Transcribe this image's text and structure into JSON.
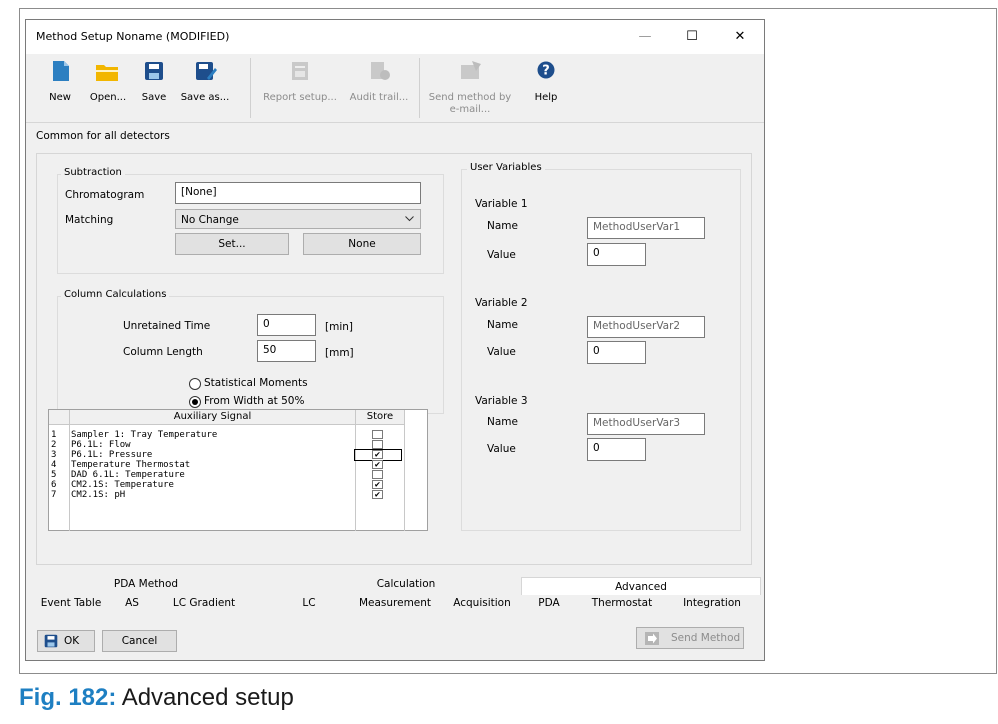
{
  "window": {
    "title": "Method Setup Noname (MODIFIED)",
    "controls": {
      "minimize": "—",
      "maximize": "☐",
      "close": "✕"
    }
  },
  "toolbar": {
    "new": "New",
    "open": "Open...",
    "save": "Save",
    "save_as": "Save as...",
    "report_setup": "Report setup...",
    "audit_trail": "Audit trail...",
    "send_method_line1": "Send method by",
    "send_method_line2": "e-mail...",
    "help": "Help"
  },
  "section_label": "Common for all detectors",
  "subtraction": {
    "title": "Subtraction",
    "chromatogram_label": "Chromatogram",
    "chromatogram_value": "[None]",
    "matching_label": "Matching",
    "matching_value": "No Change",
    "set_button": "Set...",
    "none_button": "None"
  },
  "column_calculations": {
    "title": "Column Calculations",
    "unretained_label": "Unretained Time",
    "unretained_value": "0",
    "unretained_unit": "[min]",
    "length_label": "Column Length",
    "length_value": "50",
    "length_unit": "[mm]",
    "radio_statistical": "Statistical Moments",
    "radio_width": "From Width at 50%",
    "selected": "width"
  },
  "aux_table": {
    "col_signal": "Auxiliary Signal",
    "col_store": "Store",
    "rows": [
      {
        "num": "1",
        "signal": "Sampler 1: Tray Temperature",
        "store": false,
        "check": ""
      },
      {
        "num": "2",
        "signal": "P6.1L: Flow",
        "store": false,
        "check": ""
      },
      {
        "num": "3",
        "signal": "P6.1L: Pressure",
        "store": true,
        "check": "✔"
      },
      {
        "num": "4",
        "signal": "Temperature Thermostat",
        "store": true,
        "check": "✔"
      },
      {
        "num": "5",
        "signal": "DAD 6.1L: Temperature",
        "store": false,
        "check": ""
      },
      {
        "num": "6",
        "signal": "CM2.1S: Temperature",
        "store": true,
        "check": "✔"
      },
      {
        "num": "7",
        "signal": "CM2.1S: pH",
        "store": true,
        "check": "✔"
      }
    ]
  },
  "user_variables": {
    "title": "User Variables",
    "name_label": "Name",
    "value_label": "Value",
    "vars": [
      {
        "header": "Variable 1",
        "name": "MethodUserVar1",
        "value": "0"
      },
      {
        "header": "Variable 2",
        "name": "MethodUserVar2",
        "value": "0"
      },
      {
        "header": "Variable 3",
        "name": "MethodUserVar3",
        "value": "0"
      }
    ]
  },
  "tabs_top": [
    "PDA Method",
    "Calculation",
    "Advanced"
  ],
  "tabs_bottom": [
    "Event Table",
    "AS",
    "LC Gradient",
    "LC",
    "Measurement",
    "Acquisition",
    "PDA",
    "Thermostat",
    "Integration"
  ],
  "footer": {
    "ok": "OK",
    "cancel": "Cancel",
    "send_method": "Send Method"
  },
  "caption": {
    "fig": "Fig. 182:",
    "text": "Advanced setup"
  },
  "colors": {
    "accent": "#1e7fc2",
    "icon_blue": "#1e4e8c",
    "folder": "#f2b600"
  }
}
